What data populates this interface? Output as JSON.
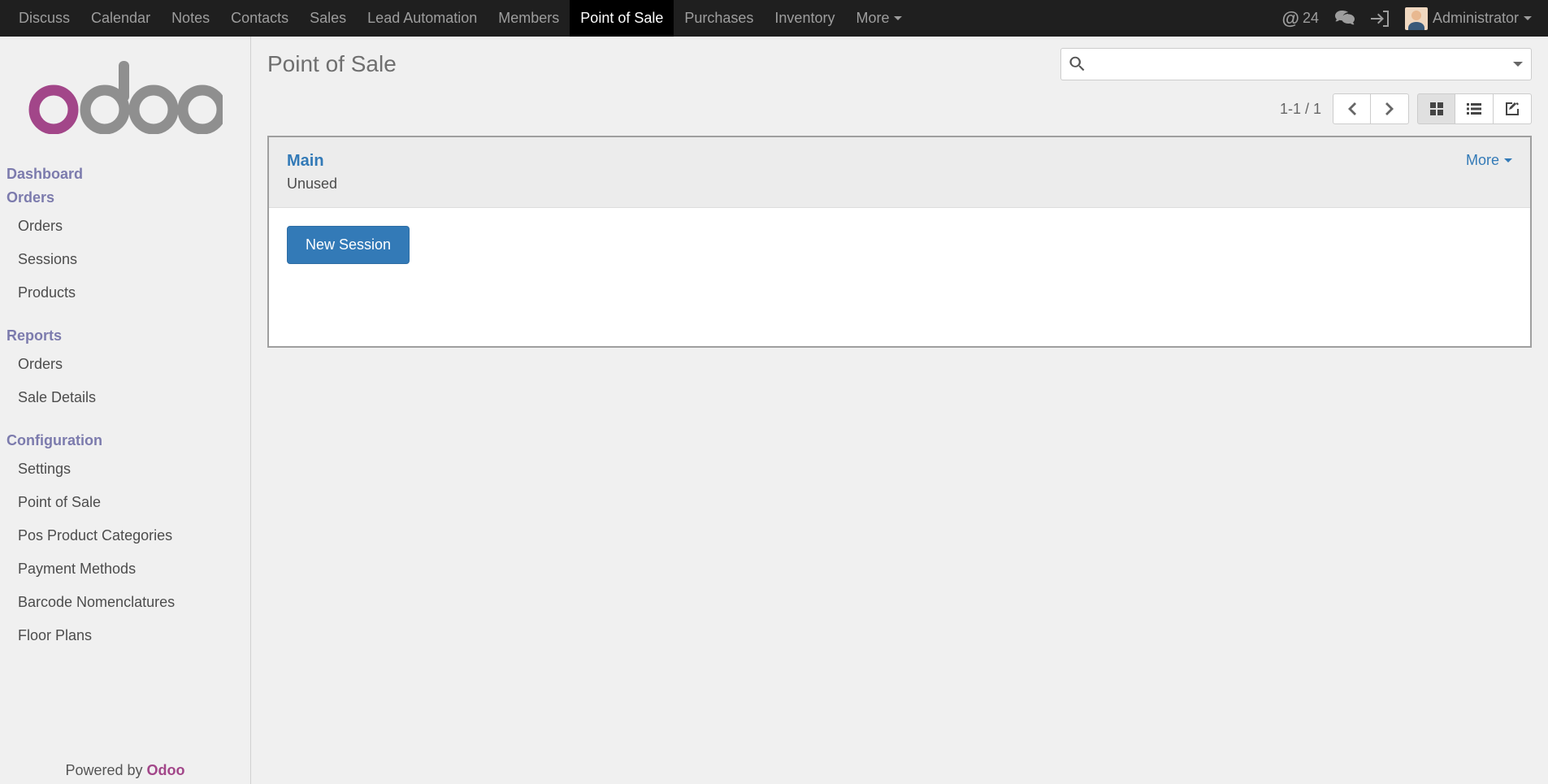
{
  "topnav": {
    "items": [
      {
        "label": "Discuss",
        "active": false
      },
      {
        "label": "Calendar",
        "active": false
      },
      {
        "label": "Notes",
        "active": false
      },
      {
        "label": "Contacts",
        "active": false
      },
      {
        "label": "Sales",
        "active": false
      },
      {
        "label": "Lead Automation",
        "active": false
      },
      {
        "label": "Members",
        "active": false
      },
      {
        "label": "Point of Sale",
        "active": true
      },
      {
        "label": "Purchases",
        "active": false
      },
      {
        "label": "Inventory",
        "active": false
      },
      {
        "label": "More",
        "active": false,
        "caret": true
      }
    ],
    "message_count": "24",
    "user_label": "Administrator"
  },
  "sidebar": {
    "groups": [
      {
        "header": "Dashboard",
        "items": []
      },
      {
        "header": "Orders",
        "items": [
          "Orders",
          "Sessions",
          "Products"
        ]
      },
      {
        "header": "Reports",
        "items": [
          "Orders",
          "Sale Details"
        ]
      },
      {
        "header": "Configuration",
        "items": [
          "Settings",
          "Point of Sale",
          "Pos Product Categories",
          "Payment Methods",
          "Barcode Nomenclatures",
          "Floor Plans"
        ]
      }
    ],
    "powered_prefix": "Powered by ",
    "powered_brand": "Odoo"
  },
  "main": {
    "title": "Point of Sale",
    "search_placeholder": "",
    "pager": "1-1 / 1",
    "card": {
      "title": "Main",
      "subtitle": "Unused",
      "more_label": "More",
      "new_session_label": "New Session"
    }
  }
}
